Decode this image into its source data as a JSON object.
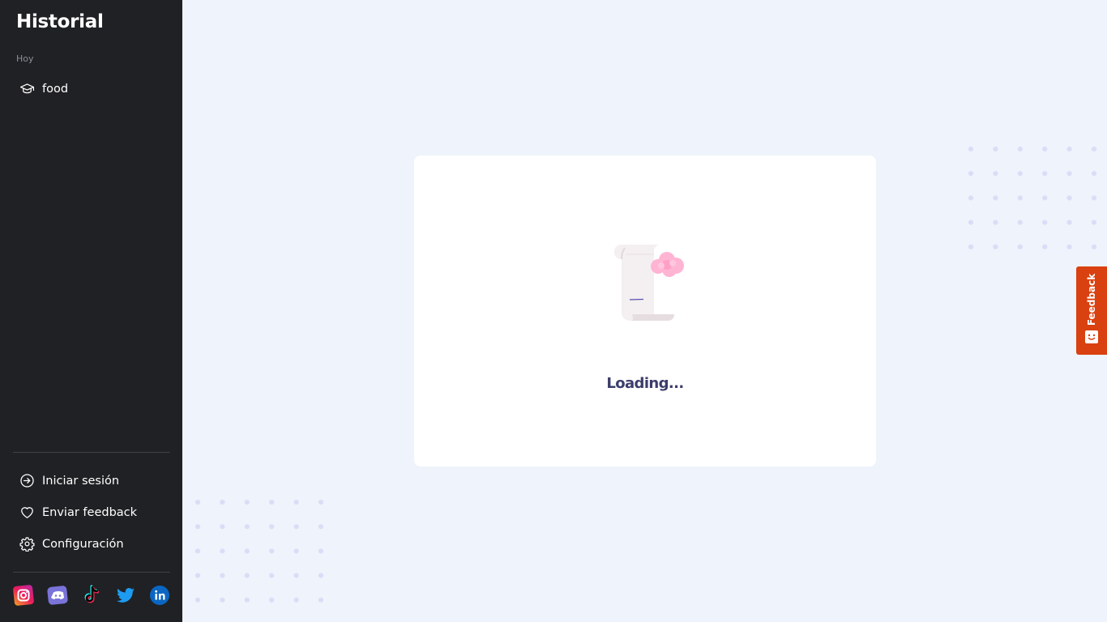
{
  "sidebar": {
    "title": "Historial",
    "section_label": "Hoy",
    "history": [
      {
        "label": "food",
        "icon": "graduation-cap-icon"
      }
    ],
    "bottom_nav": [
      {
        "label": "Iniciar sesión",
        "icon": "login-icon"
      },
      {
        "label": "Enviar feedback",
        "icon": "heart-icon"
      },
      {
        "label": "Configuración",
        "icon": "gear-icon"
      }
    ],
    "socials": [
      "instagram-icon",
      "discord-icon",
      "tiktok-icon",
      "twitter-icon",
      "linkedin-icon"
    ]
  },
  "main": {
    "loading_text": "Loading..."
  },
  "feedback_tab": {
    "label": "Feedback"
  },
  "colors": {
    "sidebar_bg": "#202124",
    "page_bg": "#eff3fb",
    "card_bg": "#ffffff",
    "loading_text": "#3c3d6b",
    "feedback_tab": "#d94110",
    "dots": "#dcdcf7"
  }
}
